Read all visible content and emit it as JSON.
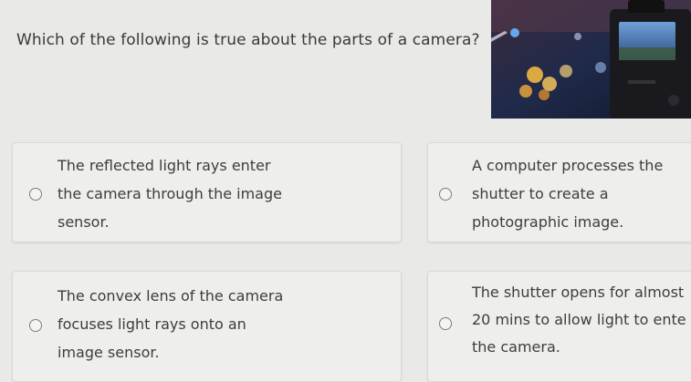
{
  "question": "Which of the following is true about the parts of a camera?",
  "image_description_icon": "camera-photo",
  "options": [
    {
      "text": "The reflected light rays enter\nthe camera through the image\nsensor."
    },
    {
      "text": "A computer processes the\nshutter to create a\nphotographic image."
    },
    {
      "text": "The convex lens of the camera\nfocuses light rays onto an\nimage sensor."
    },
    {
      "text": "The shutter opens for almost\n20 mins to allow light to ente\nthe camera."
    }
  ]
}
